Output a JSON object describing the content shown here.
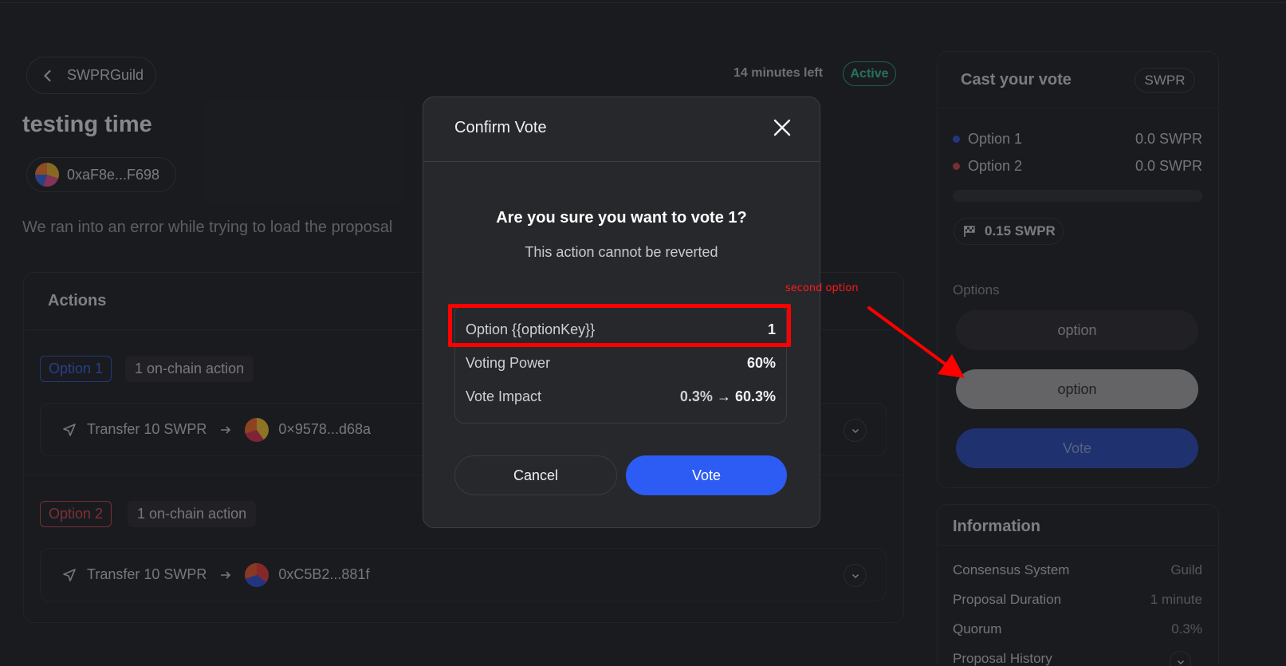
{
  "header": {
    "back_label": "SWPRGuild",
    "time_left": "14 minutes left",
    "status": "Active"
  },
  "proposal": {
    "title": "testing time",
    "author": "0xaF8e...F698",
    "error_message": "We ran into an error while trying to load the proposal"
  },
  "actions": {
    "title": "Actions",
    "groups": [
      {
        "option_label": "Option 1",
        "count_label": "1 on-chain action",
        "action_label": "Transfer 10 SWPR",
        "recipient": "0×9578...d68a"
      },
      {
        "option_label": "Option 2",
        "count_label": "1 on-chain action",
        "action_label": "Transfer 10 SWPR",
        "recipient": "0xC5B2...881f"
      }
    ]
  },
  "vote_panel": {
    "title": "Cast your vote",
    "token": "SWPR",
    "results": [
      {
        "label": "Option 1",
        "value": "0.0 SWPR",
        "color": "#2f55d4"
      },
      {
        "label": "Option 2",
        "value": "0.0 SWPR",
        "color": "#c6464a"
      }
    ],
    "quorum": "0.15 SWPR",
    "options_label": "Options",
    "option_buttons": [
      "option",
      "option"
    ],
    "vote_label": "Vote"
  },
  "info": {
    "title": "Information",
    "rows": [
      {
        "key": "Consensus System",
        "value": "Guild"
      },
      {
        "key": "Proposal Duration",
        "value": "1 minute"
      },
      {
        "key": "Quorum",
        "value": "0.3%"
      },
      {
        "key": "Proposal History",
        "value": ""
      }
    ]
  },
  "modal": {
    "title": "Confirm Vote",
    "question": "Are you sure you want to vote 1?",
    "subtitle": "This action cannot be reverted",
    "rows": [
      {
        "label": "Option {{optionKey}}",
        "value": "1"
      },
      {
        "label": "Voting Power",
        "value": "60%"
      },
      {
        "label": "Vote Impact",
        "from": "0.3%",
        "arrow": "→",
        "to": "60.3%"
      }
    ],
    "cancel_label": "Cancel",
    "confirm_label": "Vote"
  },
  "annotation": {
    "label": "second option",
    "color": "#ff0000"
  },
  "icons": [
    "chevron-left-icon",
    "send-icon",
    "arrow-right-icon",
    "chevron-down-icon",
    "flag-icon",
    "close-icon"
  ]
}
